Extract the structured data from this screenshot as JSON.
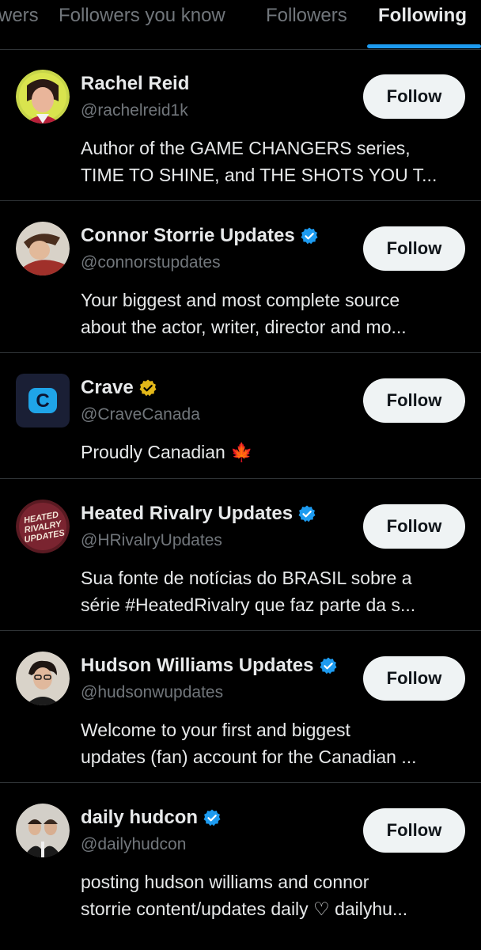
{
  "tabs": [
    {
      "label": "wers"
    },
    {
      "label": "Followers you know"
    },
    {
      "label": "Followers"
    },
    {
      "label": "Following"
    }
  ],
  "colors": {
    "accent": "#1d9bf0",
    "verified_blue": "#1d9bf0",
    "verified_gold": "#e2b719"
  },
  "users": [
    {
      "name": "Rachel Reid",
      "handle": "@rachelreid1k",
      "badge": "none",
      "bio": [
        "Author of the GAME CHANGERS series,",
        "TIME TO SHINE, and THE SHOTS YOU T..."
      ],
      "follow_label": "Follow"
    },
    {
      "name": "Connor Storrie Updates",
      "handle": "@connorstupdates",
      "badge": "verified-blue",
      "bio": [
        "Your biggest and most complete source",
        "about the actor, writer, director and mo..."
      ],
      "follow_label": "Follow"
    },
    {
      "name": "Crave",
      "handle": "@CraveCanada",
      "badge": "verified-gold",
      "bio": [
        "Proudly Canadian 🍁"
      ],
      "follow_label": "Follow"
    },
    {
      "name": "Heated Rivalry Updates",
      "handle": "@HRivalryUpdates",
      "badge": "verified-blue",
      "bio": [
        "Sua fonte de notícias do BRASIL sobre a",
        "série #HeatedRivalry que faz parte da s..."
      ],
      "follow_label": "Follow"
    },
    {
      "name": "Hudson Williams Updates",
      "handle": "@hudsonwupdates",
      "badge": "verified-blue",
      "bio": [
        "Welcome to your first and biggest",
        "updates (fan) account for the Canadian ..."
      ],
      "follow_label": "Follow"
    },
    {
      "name": "daily hudcon",
      "handle": "@dailyhudcon",
      "badge": "verified-blue",
      "bio": [
        "posting hudson williams and connor",
        "storrie content/updates daily ♡ dailyhu..."
      ],
      "follow_label": "Follow"
    }
  ],
  "avatars": {
    "crave_letter": "C",
    "heated_logo": [
      "HEATED",
      "RIVALRY",
      "UPDATES"
    ]
  }
}
